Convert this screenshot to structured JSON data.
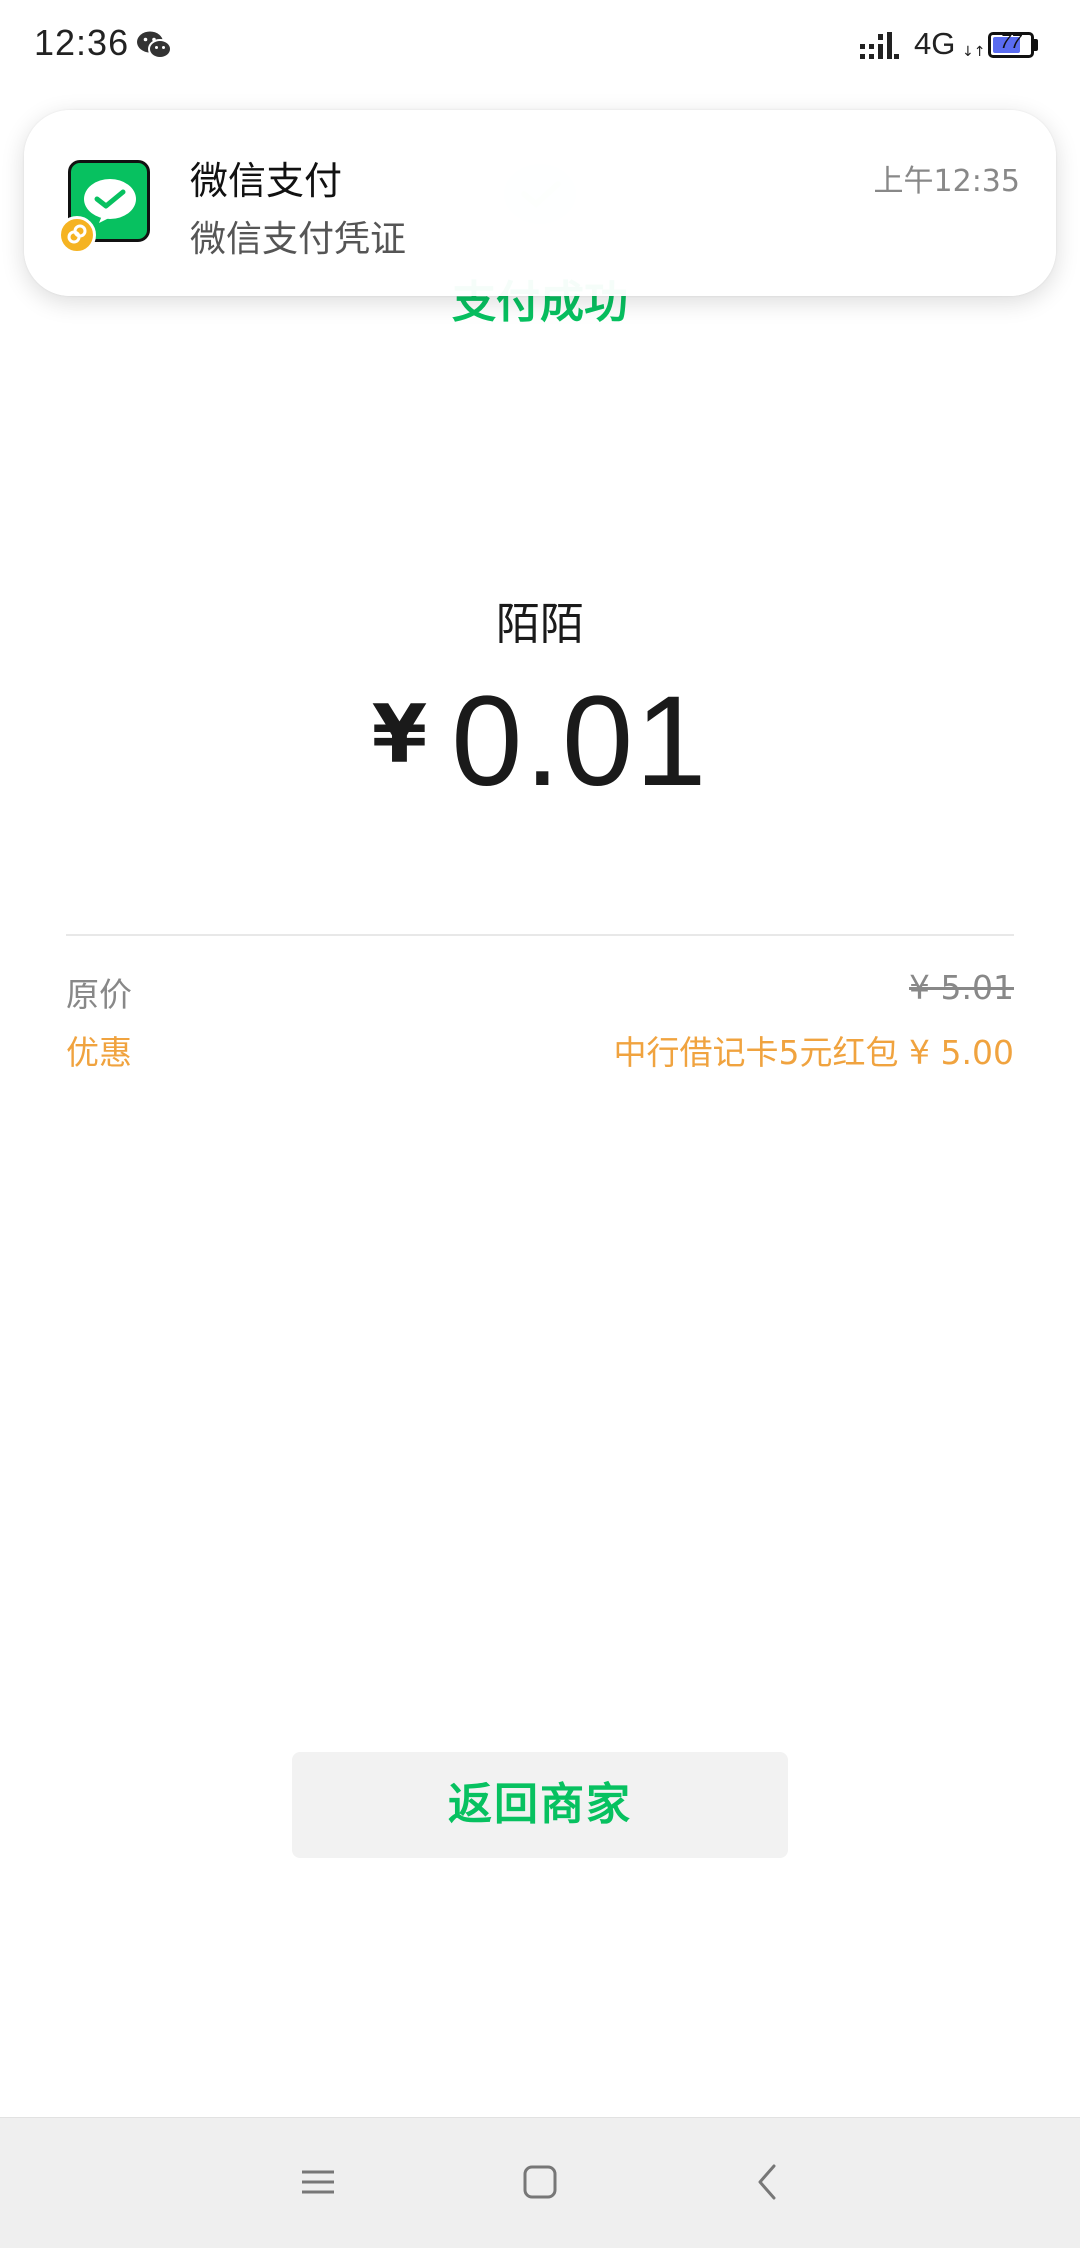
{
  "status_bar": {
    "time": "12:36",
    "network": "4G",
    "battery_level": "77",
    "battery_fraction": 0.77,
    "icons": [
      "wechat-icon",
      "signal-icon",
      "battery-icon"
    ]
  },
  "notification": {
    "title": "微信支付",
    "body": "微信支付凭证",
    "time": "上午12:35",
    "icon": "wechat-pay-icon"
  },
  "payment": {
    "status_title": "支付成功",
    "merchant": "陌陌",
    "currency_symbol": "¥",
    "amount": "0.01",
    "accent_color": "#07c160"
  },
  "details": {
    "original_label": "原价",
    "original_value": "¥ 5.01",
    "discount_label": "优惠",
    "discount_value": "中行借记卡5元红包 ¥ 5.00",
    "discount_color": "#f0a33f"
  },
  "actions": {
    "return_label": "返回商家"
  },
  "nav_bar": {
    "icons": [
      "menu-icon",
      "home-icon",
      "back-icon"
    ]
  }
}
